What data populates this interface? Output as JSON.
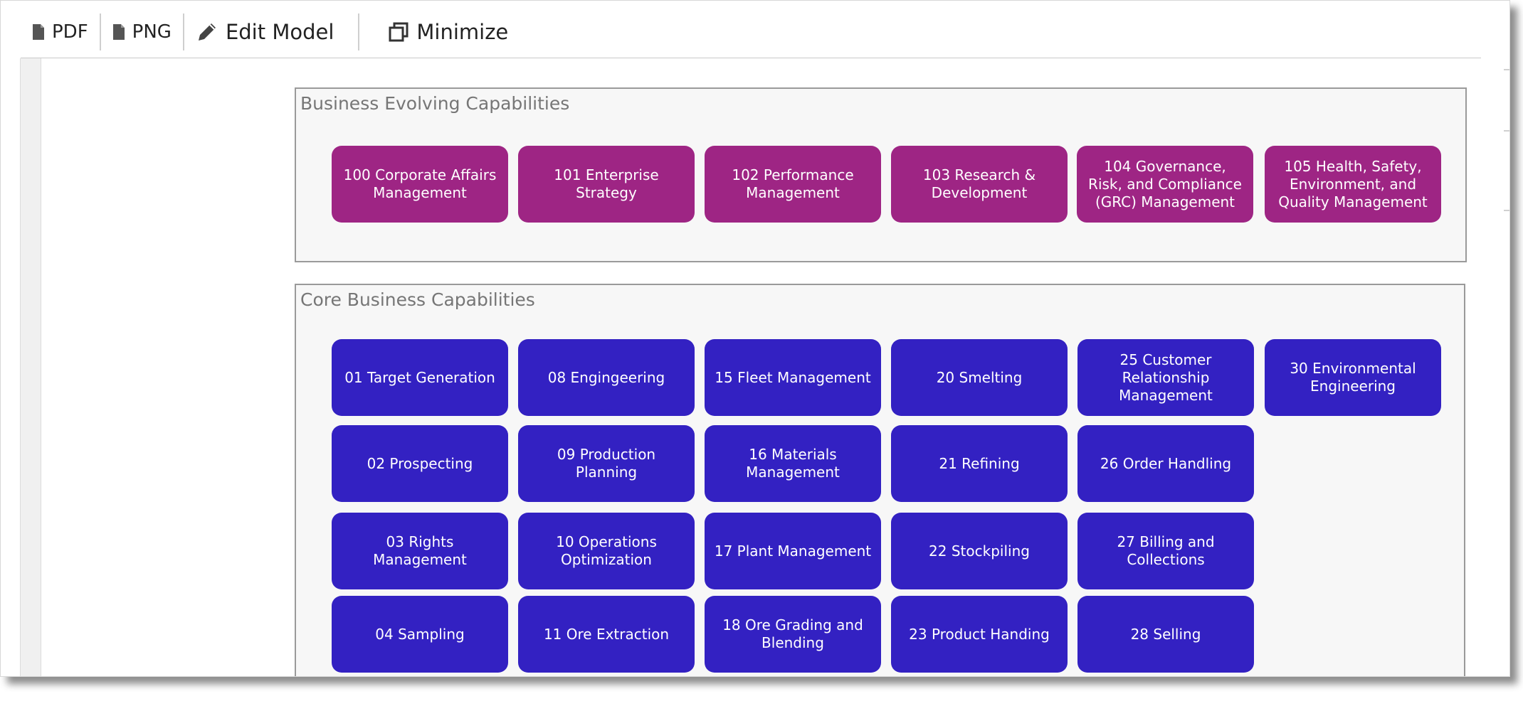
{
  "toolbar": {
    "pdf_label": "PDF",
    "png_label": "PNG",
    "edit_model_label": "Edit Model",
    "minimize_label": "Minimize"
  },
  "colors": {
    "evolving": "#9e2584",
    "core": "#3321c2"
  },
  "icons": {
    "pdf": "document-icon",
    "png": "document-icon",
    "edit": "pencil-icon",
    "minimize": "restore-window-icon"
  },
  "evolving": {
    "title": "Business Evolving Capabilities",
    "items": [
      "100 Corporate Affairs Management",
      "101 Enterprise Strategy",
      "102 Performance Management",
      "103 Research & Development",
      "104 Governance, Risk, and Compliance (GRC) Management",
      "105 Health, Safety, Environment, and Quality Management"
    ]
  },
  "core": {
    "title": "Core Business Capabilities",
    "items": [
      "01 Target Generation",
      "08 Engingeering",
      "15 Fleet Management",
      "20 Smelting",
      "25 Customer Relationship Management",
      "30 Environmental Engineering",
      "02 Prospecting",
      "09 Production Planning",
      "16 Materials Management",
      "21 Refining",
      "26 Order Handling",
      "03 Rights Management",
      "10 Operations Optimization",
      "17 Plant Management",
      "22 Stockpiling",
      "27 Billing and Collections",
      "04 Sampling",
      "11 Ore Extraction",
      "18 Ore Grading and Blending",
      "23 Product Handing",
      "28 Selling"
    ]
  }
}
